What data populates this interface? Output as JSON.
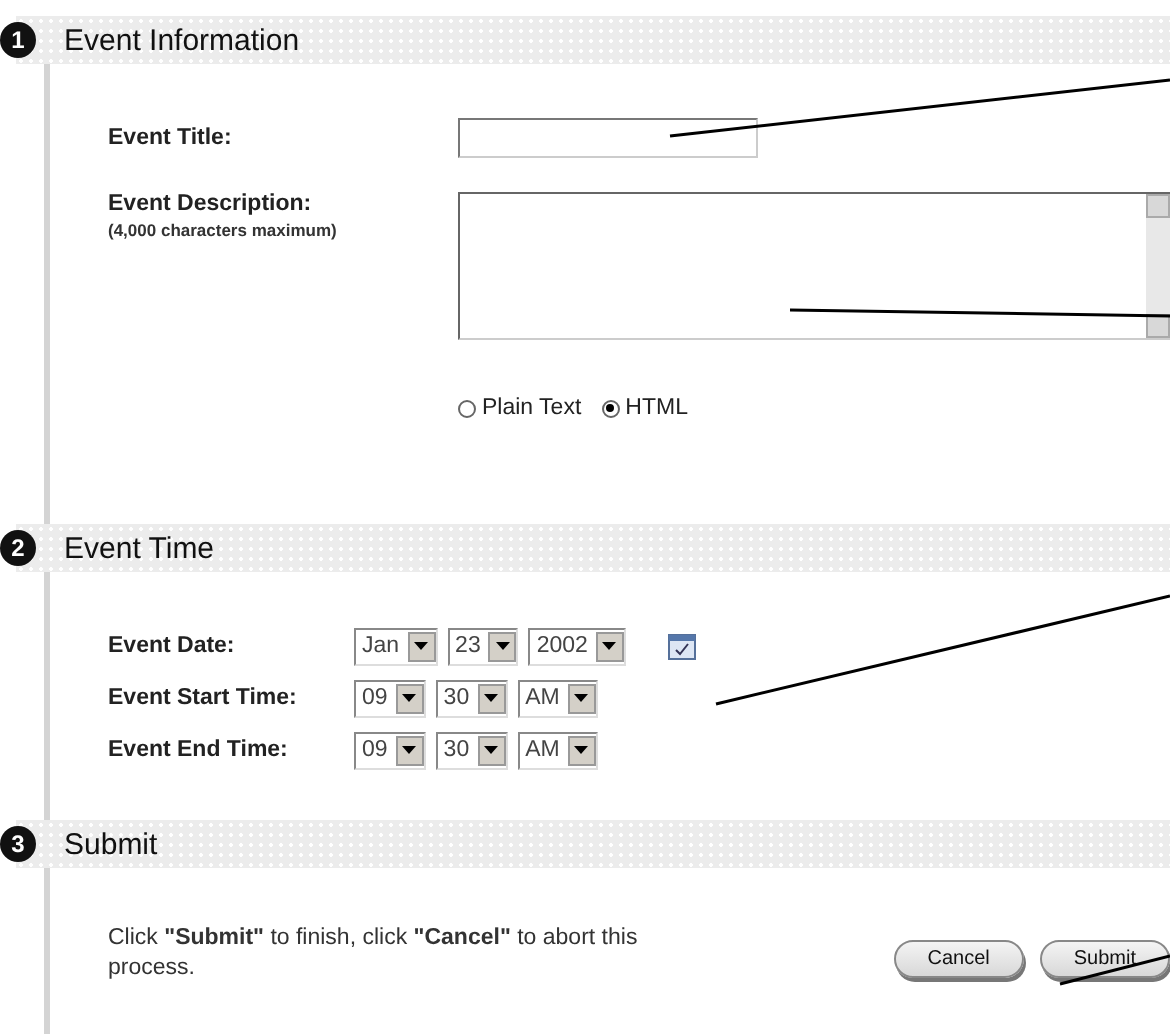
{
  "sections": [
    {
      "kind": "info",
      "number": "1",
      "title": "Event Information",
      "title_label": "Event Title:",
      "description_label": "Event Description:",
      "description_note": "(4,000 characters maximum)",
      "formats": [
        {
          "label": "Plain Text",
          "selected": false
        },
        {
          "label": "HTML",
          "selected": true
        }
      ]
    },
    {
      "kind": "time",
      "number": "2",
      "title": "Event Time",
      "rows": [
        {
          "label": "Event Date:",
          "selects": [
            "Jan",
            "23",
            "2002"
          ],
          "calendar": true
        },
        {
          "label": "Event Start Time:",
          "selects": [
            "09",
            "30",
            "AM"
          ],
          "calendar": false
        },
        {
          "label": "Event End Time:",
          "selects": [
            "09",
            "30",
            "AM"
          ],
          "calendar": false
        }
      ]
    },
    {
      "kind": "submit",
      "number": "3",
      "title": "Submit",
      "message": "Click **\"Submit\"** to finish, click **\"Cancel\"** to abort this process.",
      "buttons": [
        "Cancel",
        "Submit"
      ]
    }
  ]
}
